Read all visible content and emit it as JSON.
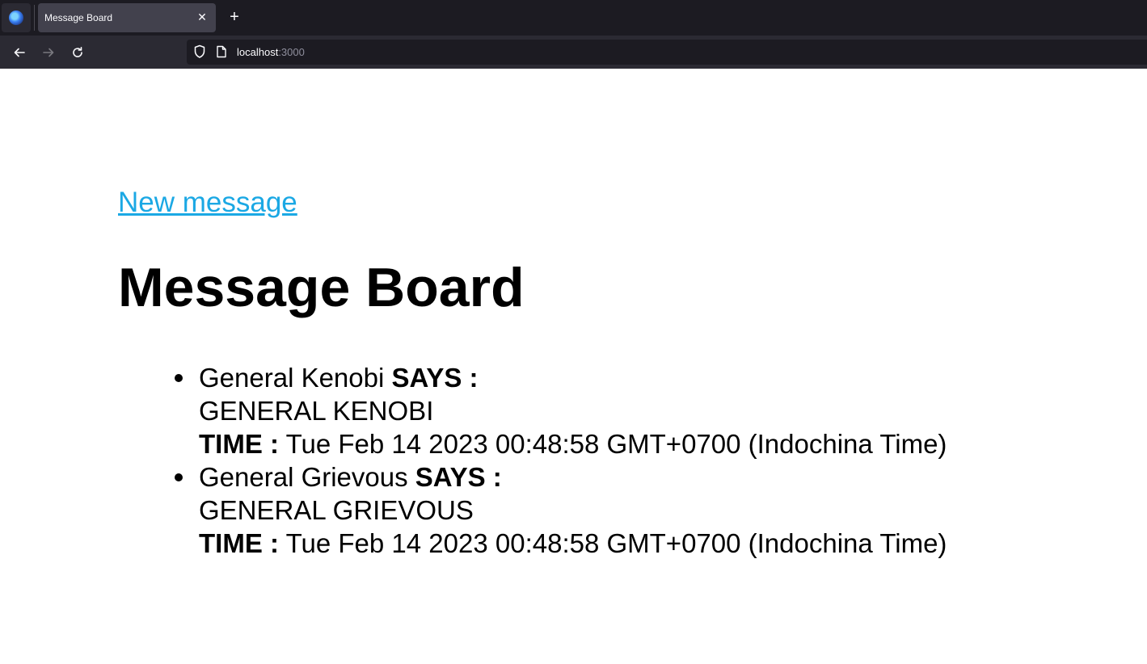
{
  "browser": {
    "tab_title": "Message Board",
    "url_host": "localhost",
    "url_port": ":3000"
  },
  "page": {
    "new_message_link": "New message",
    "title": "Message Board",
    "says_label": "SAYS :",
    "time_label": "TIME :",
    "messages": [
      {
        "user": "General Kenobi",
        "text": "GENERAL KENOBI",
        "time": "Tue Feb 14 2023 00:48:58 GMT+0700 (Indochina Time)"
      },
      {
        "user": "General Grievous",
        "text": "GENERAL GRIEVOUS",
        "time": "Tue Feb 14 2023 00:48:58 GMT+0700 (Indochina Time)"
      }
    ]
  }
}
